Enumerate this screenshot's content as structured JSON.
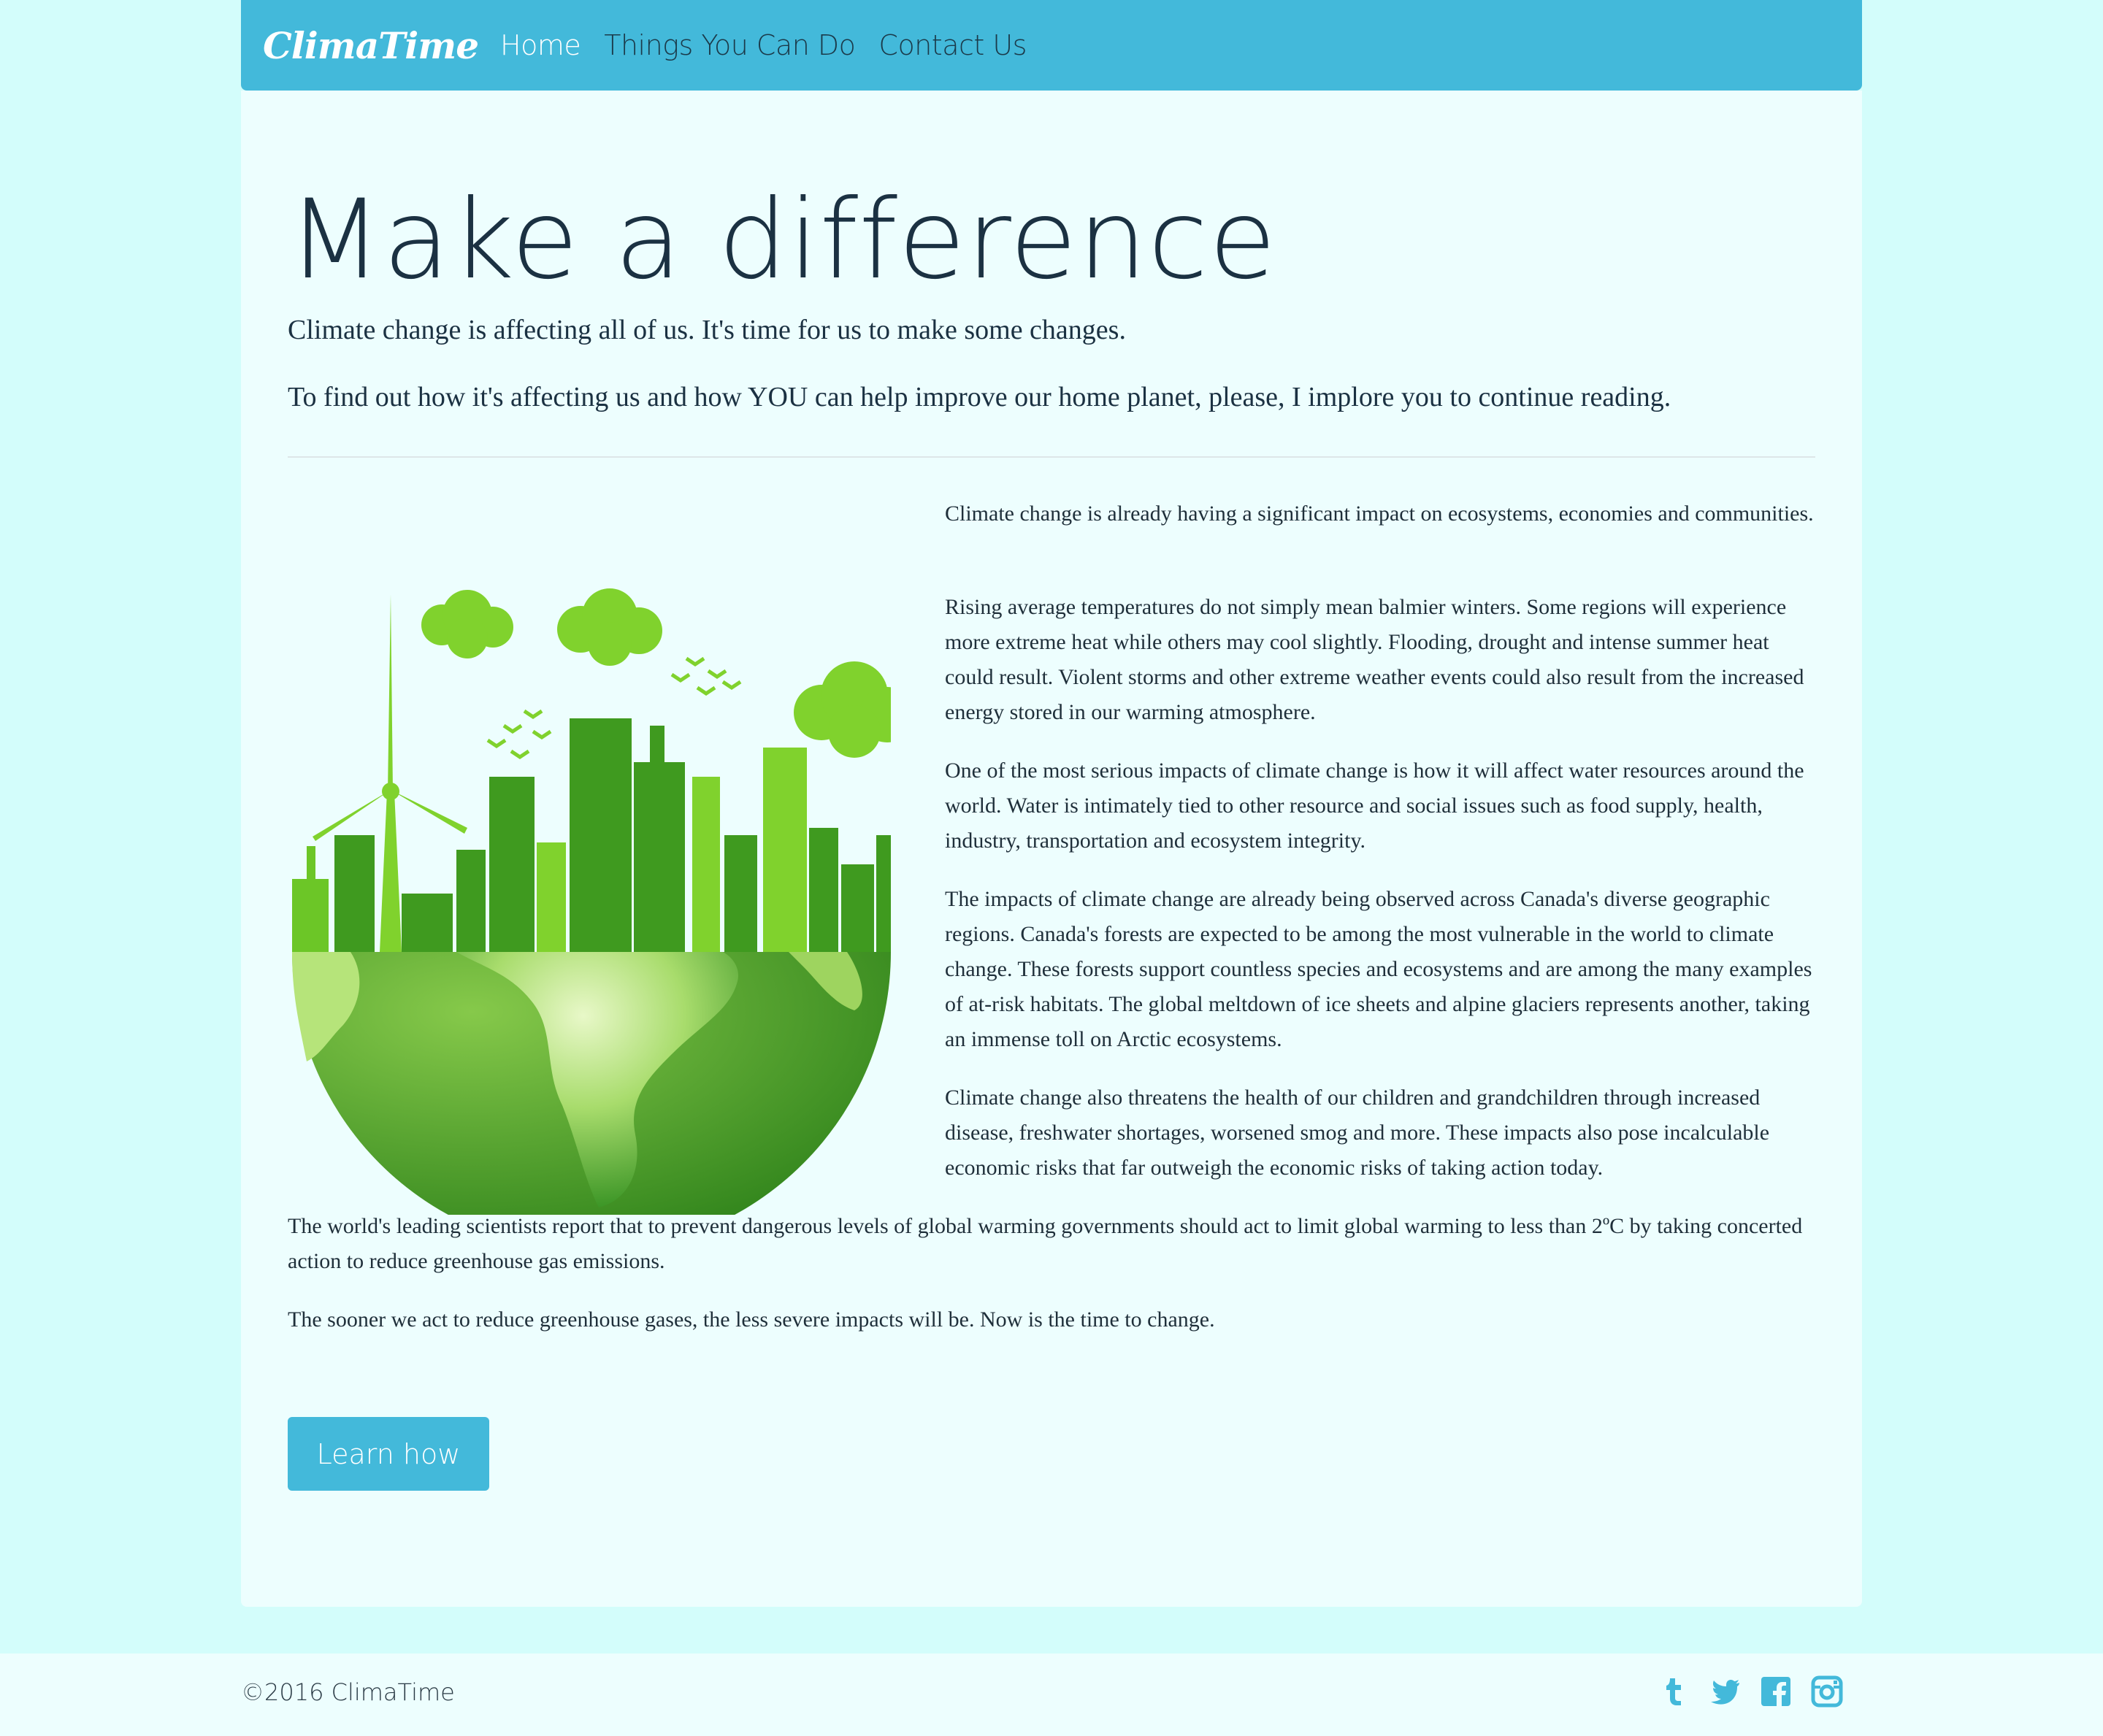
{
  "nav": {
    "brand": "ClimaTime",
    "links": [
      "Home",
      "Things You Can Do",
      "Contact Us"
    ]
  },
  "hero": {
    "title": "Make a difference",
    "lead1": "Climate change is affecting all of us. It's time for us to make some changes.",
    "lead2": "To find out how it's affecting us and how YOU can help improve our home planet, please, I implore you to continue reading."
  },
  "content": {
    "paragraphs": [
      "Climate change is already having a significant impact on ecosystems, economies and communities.",
      "Rising average temperatures do not simply mean balmier winters. Some regions will experience more extreme heat while others may cool slightly. Flooding, drought and intense summer heat could result. Violent storms and other extreme weather events could also result from the increased energy stored in our warming atmosphere.",
      "One of the most serious impacts of climate change is how it will affect water resources around the world. Water is intimately tied to other resource and social issues such as food supply, health, industry, transportation and ecosystem integrity.",
      "The impacts of climate change are already being observed across Canada's diverse geographic regions. Canada's forests are expected to be among the most vulnerable in the world to climate change. These forests support countless species and ecosystems and are among the many examples of at-risk habitats. The global meltdown of ice sheets and alpine glaciers represents another, taking an immense toll on Arctic ecosystems.",
      "Climate change also threatens the health of our children and grandchildren through increased disease, freshwater shortages, worsened smog and more. These impacts also pose incalculable economic risks that far outweigh the economic risks of taking action today.",
      "The world's leading scientists report that to prevent dangerous levels of global warming governments should act to limit global warming to less than 2ºC by taking concerted action to reduce greenhouse gas emissions.",
      "The sooner we act to reduce greenhouse gases, the less severe impacts will be. Now is the time to change."
    ],
    "button": "Learn how"
  },
  "footer": {
    "copyright": "©2016 ClimaTime",
    "socials": [
      "tumblr-icon",
      "twitter-icon",
      "facebook-icon",
      "instagram-icon"
    ]
  },
  "colors": {
    "accent": "#43b9da",
    "page_bg": "#d3fdfb",
    "panel_bg": "#edfefe",
    "green_light": "#82d42c",
    "green_dark": "#3d9a1e"
  }
}
